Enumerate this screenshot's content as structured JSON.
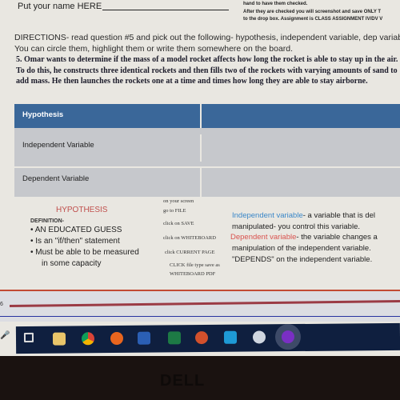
{
  "header": {
    "name_label": "Put your name HERE",
    "notes": [
      "hand to have them checked.",
      "After they are checked you will screenshot and save ONLY T",
      "to the drop box. Assignment is CLASS ASSIGNMENT IV/DV V"
    ]
  },
  "directions": "DIRECTIONS- read question #5 and pick out the following- hypothesis, independent variable, dep variable. You can circle them, highlight them or write them somewhere on the board.",
  "question": "5. Omar wants to determine if the mass of a model rocket affects how long the rocket is able to stay up in the air. To do this, he constructs three identical rockets and then fills two of the rockets with varying amounts of sand to add mass. He then launches the rockets one at a time and times how long they are able to stay airborne.",
  "table": {
    "rows": [
      "Hypothesis",
      "Independent Variable",
      "Dependent Variable"
    ]
  },
  "hypothesis": {
    "title": "HYPOTHESIS",
    "definition": "DEFINITION-",
    "bullets": [
      "AN EDUCATED GUESS",
      "Is an \"if/then\" statement",
      "Must be able to be measured",
      "in some capacity"
    ]
  },
  "save_steps": [
    "on your screen",
    "go to FILE",
    "click on SAVE",
    "click on WHITEBOARD",
    "click CURRENT PAGE",
    "CLICK file type save as",
    "WHITEBOARD PDF"
  ],
  "variables": {
    "iv_term": "Independent variable",
    "iv_def": "- a variable that is del",
    "iv_def2": "manipulated- you control this variable.",
    "dv_term": "Dependent variable",
    "dv_def": "- the variable changes a",
    "dv_def2": "manipulation of the independent variable.",
    "dv_def3": "\"DEPENDS\" on the independent variable."
  },
  "timeline": {
    "label": "6"
  },
  "taskbar": {
    "apps": [
      "task-view",
      "file-explorer",
      "chrome",
      "firefox",
      "word",
      "excel",
      "powerpoint",
      "photos",
      "cloud-app",
      "arrow-app"
    ]
  },
  "bezel": {
    "brand": "DELL"
  }
}
